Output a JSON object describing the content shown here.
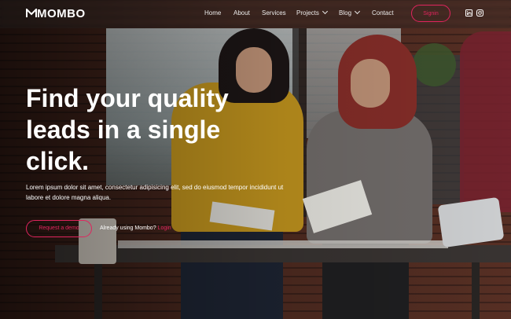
{
  "brand": {
    "name": "MOMBO",
    "accent": "#e0245e"
  },
  "nav": {
    "items": [
      {
        "label": "Home"
      },
      {
        "label": "About"
      },
      {
        "label": "Services"
      },
      {
        "label": "Projects",
        "dropdown": true
      },
      {
        "label": "Blog",
        "dropdown": true
      },
      {
        "label": "Contact"
      }
    ],
    "signin_label": "Signin",
    "social_icons": [
      "linkedin-icon",
      "instagram-icon"
    ]
  },
  "hero": {
    "headline": "Find your quality leads in a single click.",
    "description": "Lorem ipsum dolor sit amet, consectetur adipisicing elit, sed do eiusmod tempor incididunt ut labore et dolore magna aliqua.",
    "cta_label": "Request a demo",
    "already_text": "Already using Mombo?",
    "login_label": "Login"
  }
}
